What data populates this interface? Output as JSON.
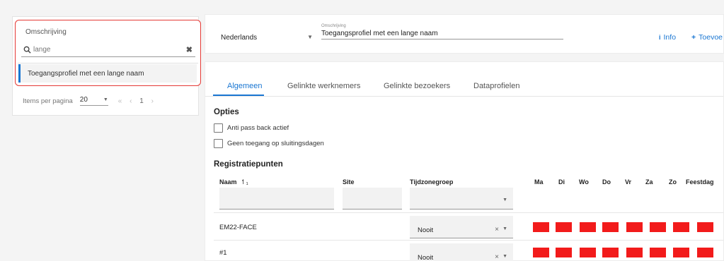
{
  "left_panel": {
    "list_header": "Omschrijving",
    "search": {
      "value": "lange"
    },
    "items": [
      "Toegangsprofiel met een lange naam"
    ],
    "pager": {
      "label": "Items per pagina",
      "page_size": "20",
      "nav_first": "«",
      "nav_prev": "‹",
      "page": "1",
      "nav_next": "›"
    }
  },
  "topbar": {
    "language": "Nederlands",
    "description_label": "Omschrijving",
    "description_value": "Toegangsprofiel met een lange naam",
    "info_label": "Info",
    "add_label": "Toevoe"
  },
  "tabs": [
    "Algemeen",
    "Gelinkte werknemers",
    "Gelinkte bezoekers",
    "Dataprofielen"
  ],
  "active_tab": "Algemeen",
  "options": {
    "title": "Opties",
    "checkboxes": [
      {
        "label": "Anti pass back actief",
        "checked": false
      },
      {
        "label": "Geen toegang op sluitingsdagen",
        "checked": false
      }
    ]
  },
  "registration_points": {
    "title": "Registratiepunten",
    "columns": {
      "name": "Naam",
      "sort_indicator": "↿₁",
      "site": "Site",
      "timezone_group": "Tijdzonegroep",
      "days": [
        "Ma",
        "Di",
        "Wo",
        "Do",
        "Vr",
        "Za",
        "Zo",
        "Feestdag"
      ]
    },
    "rows": [
      {
        "name": "EM22-FACE",
        "timezone": "Nooit",
        "clear": "×",
        "days_active": [
          false,
          false,
          false,
          false,
          false,
          false,
          false,
          false
        ]
      },
      {
        "name": "#1",
        "timezone": "Nooit",
        "clear": "×",
        "days_active": [
          false,
          false,
          false,
          false,
          false,
          false,
          false,
          false
        ]
      }
    ]
  },
  "colors": {
    "accent": "#1976d2",
    "inactive_day": "#f21b1b",
    "highlight_border": "#e53935"
  }
}
